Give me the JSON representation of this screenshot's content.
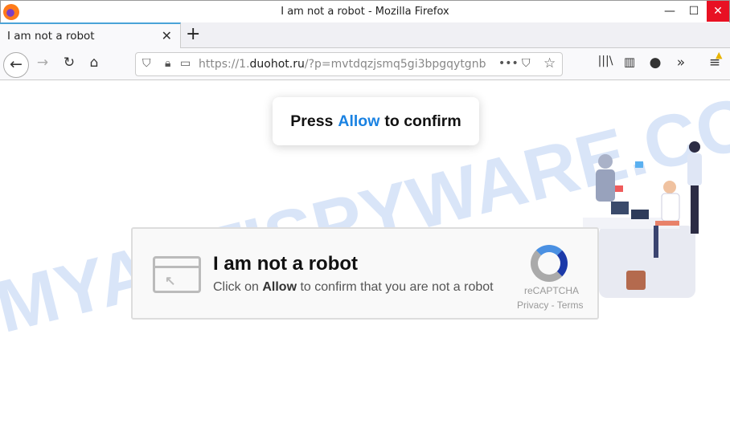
{
  "window": {
    "title": "I am not a robot - Mozilla Firefox",
    "minimize": "—",
    "maximize": "☐",
    "close": "✕"
  },
  "tab": {
    "title": "I am not a robot",
    "close": "✕",
    "new_tab": "+"
  },
  "url": {
    "scheme": "https://1.",
    "domain": "duohot.ru",
    "path": "/?p=mvtdqzjsmq5gi3bpgqytgnb"
  },
  "page": {
    "toast": {
      "before": "Press",
      "allow": "Allow",
      "after": "to confirm"
    },
    "card": {
      "title": "I am not a robot",
      "sub_before": "Click on",
      "sub_allow": "Allow",
      "sub_after": "to confirm that you are not a robot",
      "recaptcha": "reCAPTCHA",
      "links": "Privacy - Terms"
    },
    "watermark": "MYANTISPYWARE.COM"
  },
  "colors": {
    "accent": "#1a82e2",
    "close_red": "#e81123"
  }
}
